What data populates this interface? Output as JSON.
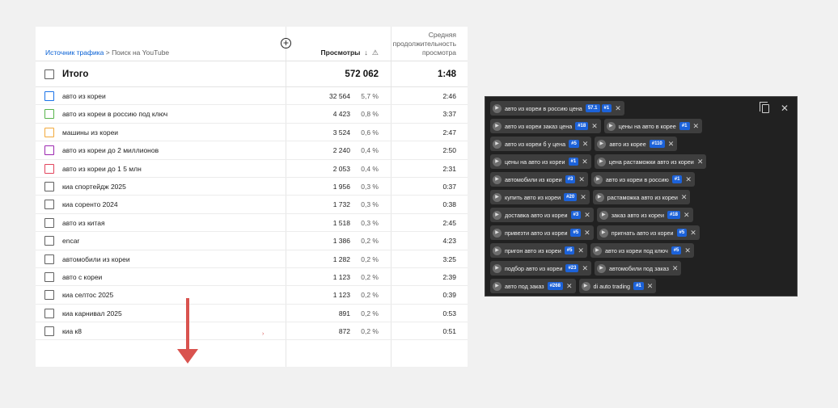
{
  "table": {
    "breadcrumb": {
      "source": "Источник трафика",
      "sep": " > ",
      "current": "Поиск на YouTube"
    },
    "add_metric": "⊕",
    "views_header": "Просмотры",
    "duration_header": "Средняя продолжительность просмотра",
    "total": {
      "label": "Итого",
      "views": "572 062",
      "duration": "1:48"
    },
    "rows": [
      {
        "query": "авто из кореи",
        "views": "32 564",
        "pct": "5,7 %",
        "dur": "2:46",
        "color": "#1a73e8"
      },
      {
        "query": "авто из кореи в россию под ключ",
        "views": "4 423",
        "pct": "0,8 %",
        "dur": "3:37",
        "color": "#56b34a"
      },
      {
        "query": "машины из кореи",
        "views": "3 524",
        "pct": "0,6 %",
        "dur": "2:47",
        "color": "#f2a93b"
      },
      {
        "query": "авто из кореи до 2 миллионов",
        "views": "2 240",
        "pct": "0,4 %",
        "dur": "2:50",
        "color": "#9c27b0"
      },
      {
        "query": "авто из кореи до 1 5 млн",
        "views": "2 053",
        "pct": "0,4 %",
        "dur": "2:31",
        "color": "#e2445c"
      },
      {
        "query": "киа спортейдж 2025",
        "views": "1 956",
        "pct": "0,3 %",
        "dur": "0:37",
        "color": "#606060"
      },
      {
        "query": "киа соренто 2024",
        "views": "1 732",
        "pct": "0,3 %",
        "dur": "0:38",
        "color": "#606060"
      },
      {
        "query": "авто из китая",
        "views": "1 518",
        "pct": "0,3 %",
        "dur": "2:45",
        "color": "#606060"
      },
      {
        "query": "encar",
        "views": "1 386",
        "pct": "0,2 %",
        "dur": "4:23",
        "color": "#606060"
      },
      {
        "query": "автомобили из кореи",
        "views": "1 282",
        "pct": "0,2 %",
        "dur": "3:25",
        "color": "#606060"
      },
      {
        "query": "авто с кореи",
        "views": "1 123",
        "pct": "0,2 %",
        "dur": "2:39",
        "color": "#606060"
      },
      {
        "query": "киа селтос 2025",
        "views": "1 123",
        "pct": "0,2 %",
        "dur": "0:39",
        "color": "#606060"
      },
      {
        "query": "киа карнивал 2025",
        "views": "891",
        "pct": "0,2 %",
        "dur": "0:53",
        "color": "#606060"
      },
      {
        "query": "киа к8",
        "views": "872",
        "pct": "0,2 %",
        "dur": "0:51",
        "color": "#606060"
      }
    ],
    "tiny_mark": "›"
  },
  "keywords": {
    "chips": [
      {
        "text": "авто из кореи в россию цена",
        "badges": [
          "57.1",
          "#1"
        ]
      },
      {
        "text": "авто из кореи заказ цена",
        "badges": [
          "#18"
        ]
      },
      {
        "text": "цены на авто в корее",
        "badges": [
          "#1"
        ]
      },
      {
        "text": "авто из кореи б у цена",
        "badges": [
          "#5"
        ]
      },
      {
        "text": "авто из корее",
        "badges": [
          "#110"
        ]
      },
      {
        "text": "цены на авто из кореи",
        "badges": [
          "#1"
        ]
      },
      {
        "text": "цена растаможки авто из кореи",
        "badges": []
      },
      {
        "text": "автомобили из кореи",
        "badges": [
          "#3"
        ]
      },
      {
        "text": "авто из кореи в россию",
        "badges": [
          "#1"
        ]
      },
      {
        "text": "купить авто из кореи",
        "badges": [
          "#20"
        ]
      },
      {
        "text": "растаможка авто из кореи",
        "badges": []
      },
      {
        "text": "доставка авто из кореи",
        "badges": [
          "#3"
        ]
      },
      {
        "text": "заказ авто из кореи",
        "badges": [
          "#18"
        ]
      },
      {
        "text": "привезти авто из кореи",
        "badges": [
          "#5"
        ]
      },
      {
        "text": "пригнать авто из кореи",
        "badges": [
          "#5"
        ]
      },
      {
        "text": "пригон авто из кореи",
        "badges": [
          "#5"
        ]
      },
      {
        "text": "авто из кореи под ключ",
        "badges": [
          "#5"
        ]
      },
      {
        "text": "подбор авто из кореи",
        "badges": [
          "#23"
        ]
      },
      {
        "text": "автомобили под заказ",
        "badges": []
      },
      {
        "text": "авто под заказ",
        "badges": [
          "#268"
        ]
      },
      {
        "text": "di auto trading",
        "badges": [
          "#1"
        ]
      }
    ],
    "chip_icon": "play-icon",
    "remove_icon": "✕",
    "copy_icon": "copy-icon",
    "close_icon": "✕"
  }
}
